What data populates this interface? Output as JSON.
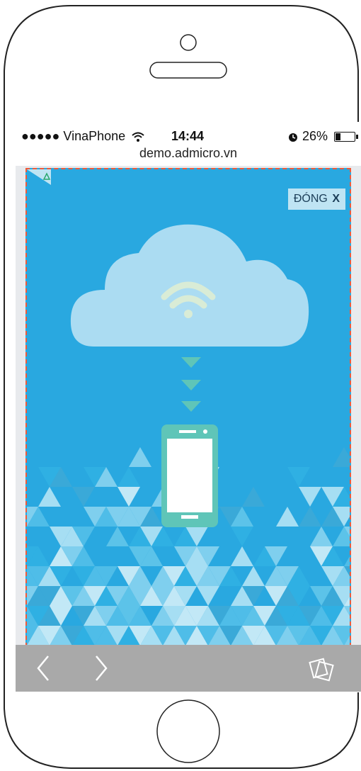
{
  "status": {
    "carrier": "VinaPhone",
    "time": "14:44",
    "battery": "26%",
    "battery_level": 0.26
  },
  "browser": {
    "url": "demo.admicro.vn"
  },
  "ad": {
    "close_label": "ĐÓNG",
    "close_x": "X",
    "colors": {
      "background": "#29a8e0",
      "cloud": "#abdcf2",
      "accent": "#5fc5b8",
      "border": "#ef5a3a"
    }
  },
  "icons": {
    "back": "chevron-left-icon",
    "forward": "chevron-right-icon",
    "tabs": "tabs-icon",
    "wifi": "wifi-icon",
    "alarm": "alarm-icon",
    "battery": "battery-icon"
  }
}
